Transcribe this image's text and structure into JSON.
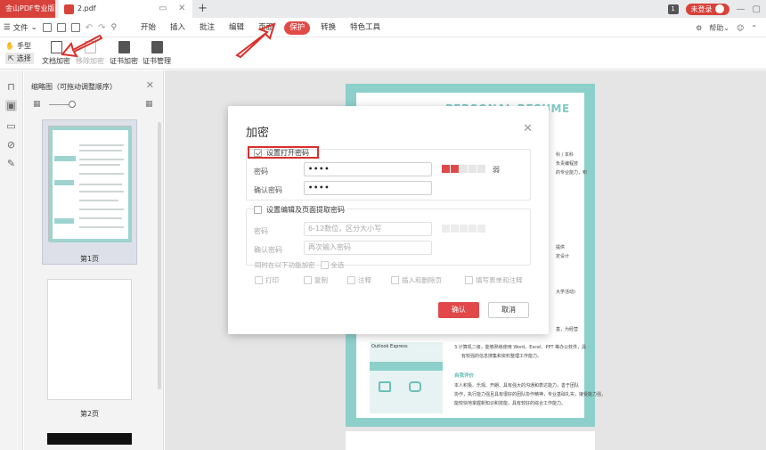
{
  "titlebar": {
    "app_tab": "金山PDF专业版",
    "doc_tab": "2.pdf",
    "add_tab": "+",
    "badge": "1",
    "user_name": "未登录"
  },
  "menubar": {
    "file": "文件",
    "tabs": [
      {
        "label": "开始"
      },
      {
        "label": "插入"
      },
      {
        "label": "批注"
      },
      {
        "label": "编辑"
      },
      {
        "label": "页面"
      },
      {
        "label": "保护"
      },
      {
        "label": "转换"
      },
      {
        "label": "特色工具"
      }
    ],
    "help": "帮助"
  },
  "toolbar": {
    "hand": "手型",
    "select": "选择",
    "buttons": [
      {
        "label": "文档加密",
        "enabled": true
      },
      {
        "label": "移除加密",
        "enabled": false
      },
      {
        "label": "证书加密",
        "enabled": true
      },
      {
        "label": "证书管理",
        "enabled": true
      }
    ]
  },
  "thumbnails": {
    "title": "缩略图（可拖动调整顺序）",
    "pages": [
      {
        "label": "第1页"
      },
      {
        "label": "第2页"
      }
    ]
  },
  "resume": {
    "title": "PERSONAL RESUME",
    "lines": [
      "科 / 本科",
      "负责编程技",
      "的专业能力，积",
      "提供",
      "定设计",
      "大学活动)",
      "基，为经营",
      "3.计算机二级，能够熟练使用 Word、Excel、PPT 等办公软件，具",
      "有较强的信息搜集和资料整理工作能力。",
      "本人积极、乐观、开朗、具有强大的沟通和表达能力，善于团队",
      "协作，执行能力强且具有很好的团队协作精神，专业基础扎实，接受能力强，",
      "能较快地掌握新知识和技能，具有较好的综合工作能力。"
    ],
    "highlight": "自我评价",
    "panel_text": "Outlook Express"
  },
  "dialog": {
    "title": "加密",
    "open_password": {
      "label": "设置打开密码",
      "checked": true,
      "password_label": "密码",
      "password_value": "••••",
      "confirm_label": "确认密码",
      "confirm_value": "••••",
      "strength_text": "弱"
    },
    "edit_password": {
      "label": "设置编辑及页面提取密码",
      "checked": false,
      "password_label": "密码",
      "password_placeholder": "6-12数位，区分大小写",
      "confirm_label": "确认密码",
      "confirm_placeholder": "再次输入密码"
    },
    "permissions": {
      "label": "同时在以下功能加密",
      "select_all": "全选",
      "items": [
        "打印",
        "复制",
        "注释",
        "插入和删除页",
        "填写表单和注释"
      ]
    },
    "ok": "确认",
    "cancel": "取消"
  },
  "colors": {
    "brand_red": "#d7423b",
    "accent_teal": "#8dd0cb",
    "strength_red": "#e0484a"
  }
}
